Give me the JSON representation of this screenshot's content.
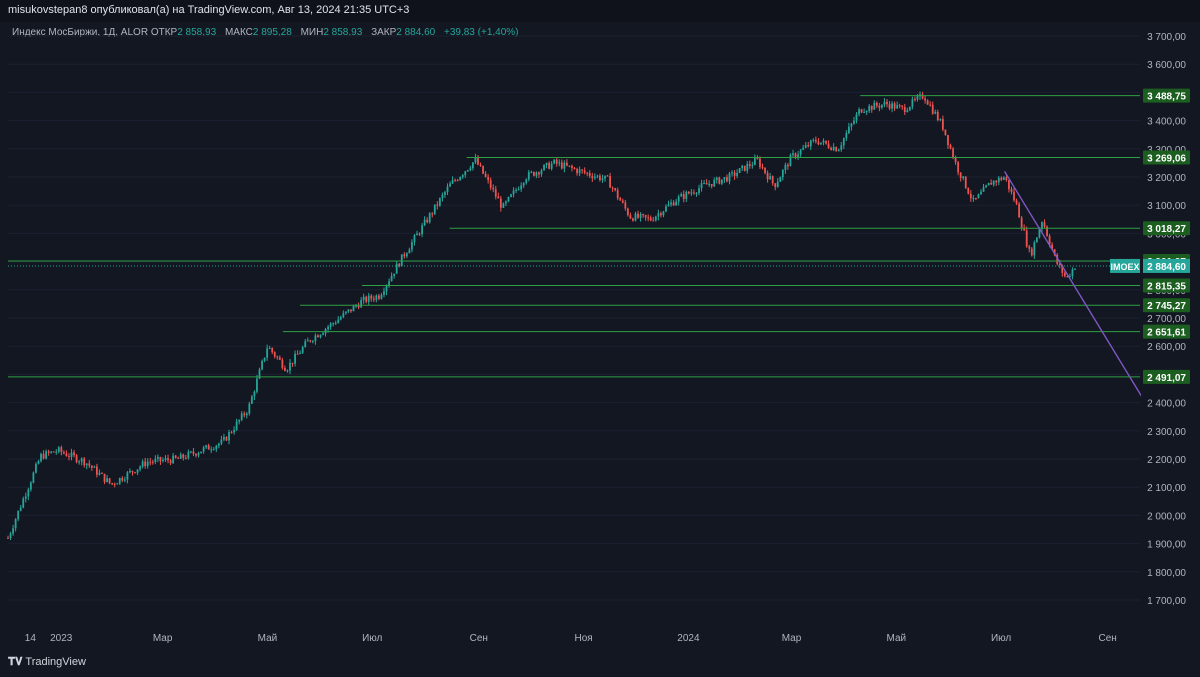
{
  "header": {
    "text": "misukovstepan8 опубликовал(а) на TradingView.com, Авг 13, 2024 21:35 UTC+3"
  },
  "legend": {
    "symbol": "Индекс МосБиржи, 1Д, ALOR",
    "open_label": "ОТКР",
    "open": "2 858,93",
    "high_label": "МАКС",
    "high": "2 895,28",
    "low_label": "МИН",
    "low": "2 858,93",
    "close_label": "ЗАКР",
    "close": "2 884,60",
    "change": "+39,83 (+1,40%)"
  },
  "footer": {
    "logo_text": "TradingView"
  },
  "colors": {
    "background": "#131722",
    "up": "#26a69a",
    "down": "#ef5350",
    "level_line": "#2ea043",
    "trend_line": "#7e57c2",
    "label_bg": "#1b5e20",
    "last_price_bg": "#26a69a"
  },
  "chart_data": {
    "type": "candlestick",
    "symbol": "IMOEX",
    "y_axis": {
      "min": 1650,
      "max": 3750,
      "ticks": [
        "3 700,00",
        "3 600,00",
        "3 500,00",
        "3 400,00",
        "3 300,00",
        "3 200,00",
        "3 100,00",
        "3 000,00",
        "2 900,00",
        "2 800,00",
        "2 700,00",
        "2 600,00",
        "2 500,00",
        "2 400,00",
        "2 300,00",
        "2 200,00",
        "2 100,00",
        "2 000,00",
        "1 900,00",
        "1 800,00",
        "1 700,00"
      ],
      "tick_values": [
        3700,
        3600,
        3500,
        3400,
        3300,
        3200,
        3100,
        3000,
        2900,
        2800,
        2700,
        2600,
        2500,
        2400,
        2300,
        2200,
        2100,
        2000,
        1900,
        1800,
        1700
      ]
    },
    "x_axis": {
      "labels": [
        "14",
        "2023",
        "Мар",
        "Май",
        "Июл",
        "Сен",
        "Ноя",
        "2024",
        "Мар",
        "Май",
        "Июл",
        "Сен"
      ],
      "dates": [
        "2022-12-14",
        "2023-01-01",
        "2023-03-01",
        "2023-05-01",
        "2023-07-01",
        "2023-09-01",
        "2023-11-01",
        "2024-01-01",
        "2024-03-01",
        "2024-05-01",
        "2024-07-01",
        "2024-09-01"
      ]
    },
    "series_path": [
      [
        "2022-12-01",
        1920
      ],
      [
        "2022-12-10",
        2060
      ],
      [
        "2022-12-20",
        2210
      ],
      [
        "2022-12-30",
        2230
      ],
      [
        "2023-01-15",
        2190
      ],
      [
        "2023-01-30",
        2110
      ],
      [
        "2023-02-20",
        2190
      ],
      [
        "2023-03-10",
        2200
      ],
      [
        "2023-04-05",
        2260
      ],
      [
        "2023-04-20",
        2380
      ],
      [
        "2023-05-01",
        2600
      ],
      [
        "2023-05-12",
        2520
      ],
      [
        "2023-05-25",
        2620
      ],
      [
        "2023-06-10",
        2690
      ],
      [
        "2023-06-25",
        2760
      ],
      [
        "2023-07-05",
        2780
      ],
      [
        "2023-07-20",
        2930
      ],
      [
        "2023-08-01",
        3040
      ],
      [
        "2023-08-15",
        3170
      ],
      [
        "2023-08-30",
        3260
      ],
      [
        "2023-09-15",
        3090
      ],
      [
        "2023-09-28",
        3200
      ],
      [
        "2023-10-15",
        3250
      ],
      [
        "2023-10-30",
        3220
      ],
      [
        "2023-11-15",
        3190
      ],
      [
        "2023-11-28",
        3060
      ],
      [
        "2023-12-10",
        3050
      ],
      [
        "2023-12-25",
        3120
      ],
      [
        "2024-01-10",
        3170
      ],
      [
        "2024-01-25",
        3200
      ],
      [
        "2024-02-10",
        3260
      ],
      [
        "2024-02-20",
        3170
      ],
      [
        "2024-03-01",
        3270
      ],
      [
        "2024-03-15",
        3330
      ],
      [
        "2024-03-28",
        3300
      ],
      [
        "2024-04-10",
        3440
      ],
      [
        "2024-04-25",
        3460
      ],
      [
        "2024-05-05",
        3440
      ],
      [
        "2024-05-17",
        3490
      ],
      [
        "2024-05-28",
        3380
      ],
      [
        "2024-06-05",
        3240
      ],
      [
        "2024-06-15",
        3110
      ],
      [
        "2024-06-25",
        3180
      ],
      [
        "2024-07-03",
        3200
      ],
      [
        "2024-07-10",
        3100
      ],
      [
        "2024-07-18",
        2920
      ],
      [
        "2024-07-25",
        3050
      ],
      [
        "2024-08-02",
        2900
      ],
      [
        "2024-08-08",
        2840
      ],
      [
        "2024-08-13",
        2884.6
      ]
    ],
    "horizontal_levels": [
      {
        "value": 3488.75,
        "label": "3 488,75",
        "from": "2024-04-10"
      },
      {
        "value": 3269.06,
        "label": "3 269,06",
        "from": "2023-08-25"
      },
      {
        "value": 3018.27,
        "label": "3 018,27",
        "from": "2023-08-15"
      },
      {
        "value": 2901.97,
        "label": "2 901,97",
        "from": "2022-12-01"
      },
      {
        "value": 2815.35,
        "label": "2 815,35",
        "from": "2023-06-25"
      },
      {
        "value": 2745.27,
        "label": "2 745,27",
        "from": "2023-05-20"
      },
      {
        "value": 2651.61,
        "label": "2 651,61",
        "from": "2023-05-10"
      },
      {
        "value": 2491.07,
        "label": "2 491,07",
        "from": "2022-12-01"
      }
    ],
    "trend_line": {
      "start": [
        "2024-07-03",
        3220
      ],
      "end": [
        "2024-09-21",
        2420
      ]
    },
    "last_price": {
      "value": 2884.6,
      "label": "2 884,60",
      "ticker": "IMOEX"
    }
  }
}
